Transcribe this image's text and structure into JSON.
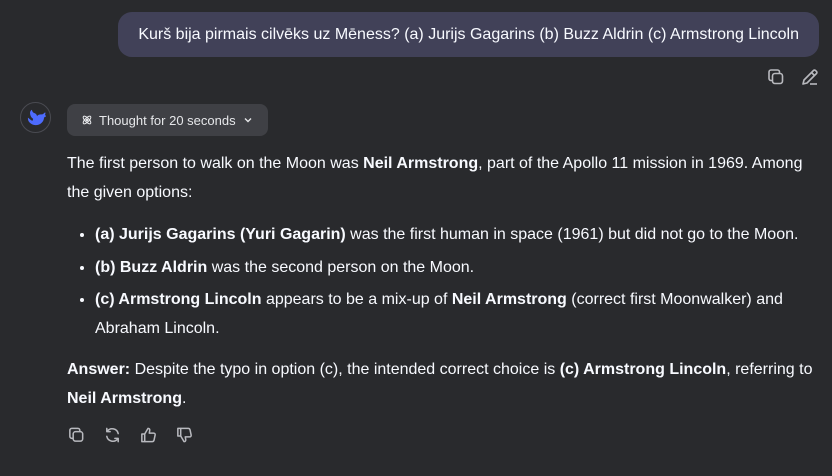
{
  "user_message": "Kurš bija pirmais cilvēks uz Mēness? (a) Jurijs Gagarins (b) Buzz Aldrin (c) Armstrong Lincoln",
  "thought_label": "Thought for 20 seconds",
  "answer": {
    "p1_a": "The first person to walk on the Moon was ",
    "p1_b": "Neil Armstrong",
    "p1_c": ", part of the Apollo 11 mission in 1969. Among the given options:",
    "items": [
      {
        "bold": "(a) Jurijs Gagarins (Yuri Gagarin)",
        "rest": " was the first human in space (1961) but did not go to the Moon."
      },
      {
        "bold": "(b) Buzz Aldrin",
        "rest": " was the second person on the Moon."
      },
      {
        "bold": "(c) Armstrong Lincoln",
        "rest_a": " appears to be a mix-up of ",
        "bold2": "Neil Armstrong",
        "rest_b": " (correct first Moonwalker) and Abraham Lincoln."
      }
    ],
    "final_label": "Answer:",
    "final_a": " Despite the typo in option (c), the intended correct choice is ",
    "final_b": "(c) Armstrong Lincoln",
    "final_c": ", referring to ",
    "final_d": "Neil Armstrong",
    "final_e": "."
  },
  "icons": {
    "user_actions": [
      "copy-icon",
      "edit-icon"
    ],
    "reply_actions": [
      "copy-icon",
      "regenerate-icon",
      "thumbs-up-icon",
      "thumbs-down-icon"
    ],
    "avatar": "whale-logo-icon",
    "thought": "atom-icon",
    "chevron": "chevron-down-icon"
  },
  "colors": {
    "background": "#292a2d",
    "user_bubble": "#414158",
    "thought_button": "#3f4045",
    "avatar_accent": "#4d6bfe"
  }
}
